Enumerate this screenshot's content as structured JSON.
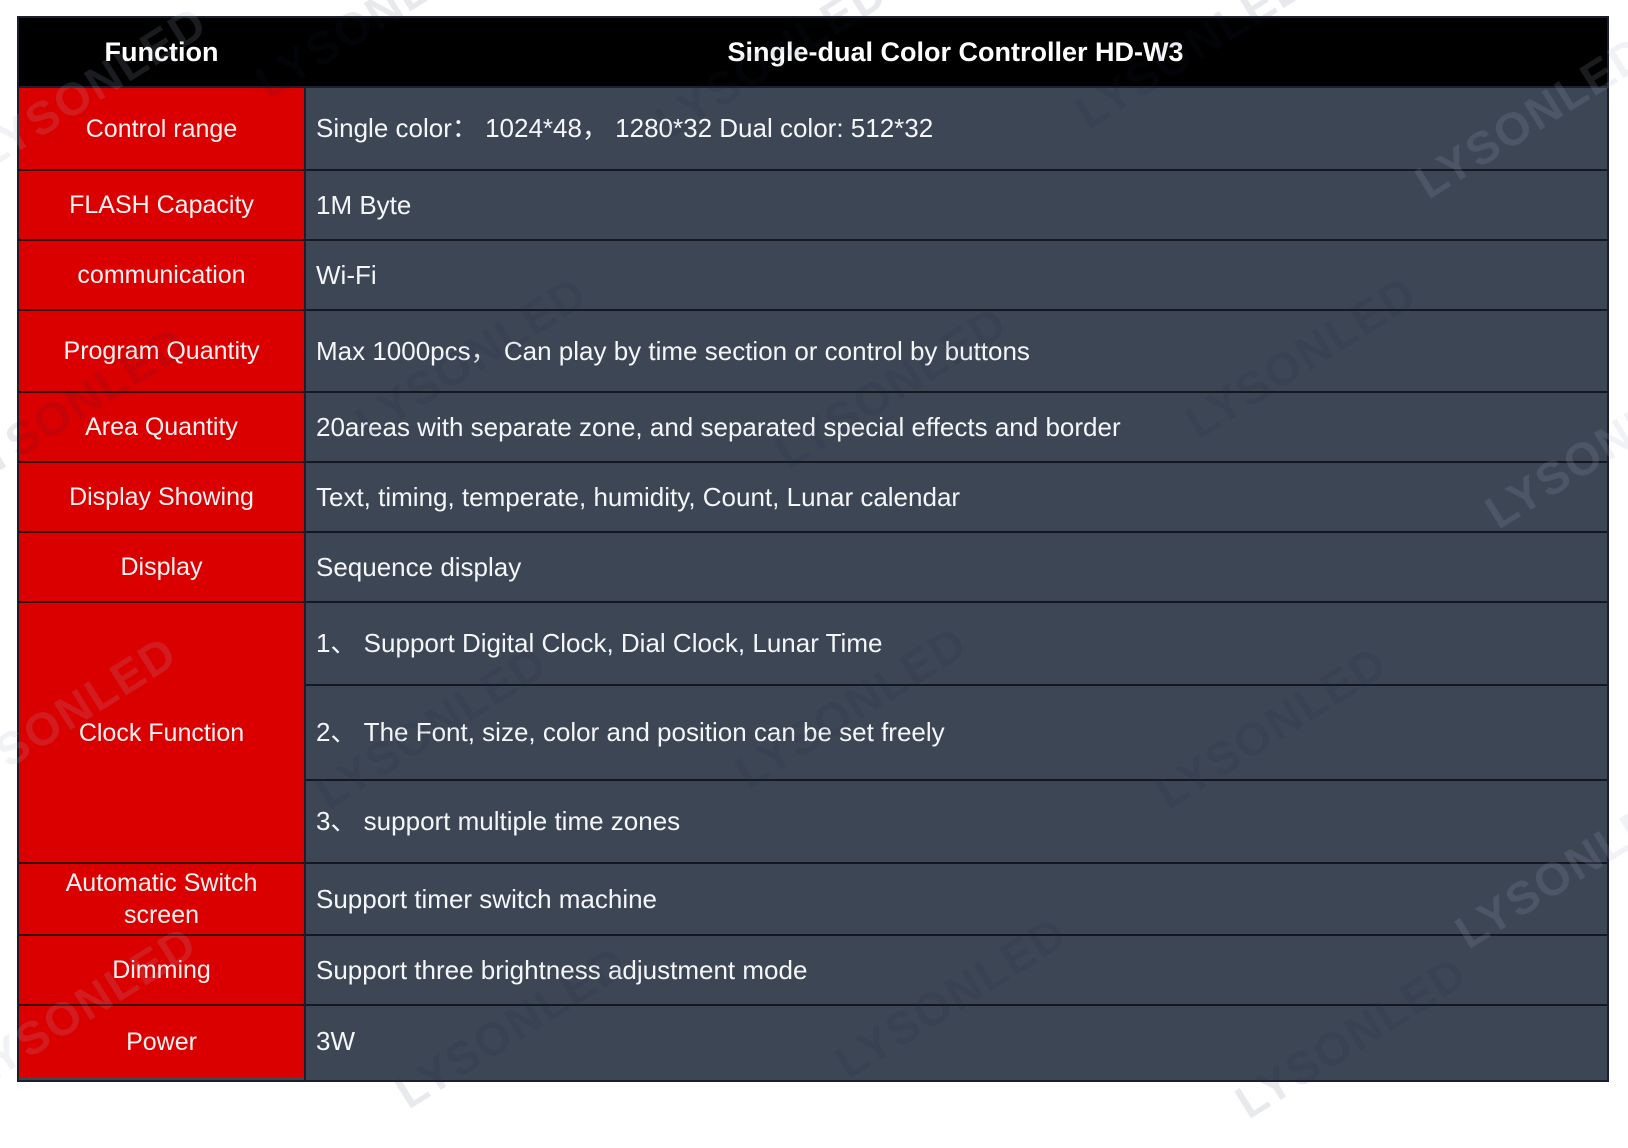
{
  "table": {
    "header": {
      "function_label": "Function",
      "model_label": "Single-dual Color Controller HD-W3"
    },
    "rows": [
      {
        "function": "Control range",
        "value": "Single color：  1024*48，  1280*32      Dual color: 512*32"
      },
      {
        "function": "FLASH Capacity",
        "value": "1M Byte"
      },
      {
        "function": "communication",
        "value": "Wi-Fi"
      },
      {
        "function": "Program Quantity",
        "value": "Max 1000pcs，  Can play by time section or control by buttons"
      },
      {
        "function": "Area Quantity",
        "value": "20areas with separate zone, and separated special effects and border"
      },
      {
        "function": "Display Showing",
        "value": "Text, timing, temperate, humidity, Count, Lunar calendar"
      },
      {
        "function": "Display",
        "value": "Sequence display"
      },
      {
        "function": "Clock Function",
        "value": null,
        "sub_values": [
          "1、 Support Digital Clock, Dial Clock, Lunar Time",
          "2、 The Font, size, color and position can be set freely",
          "3、 support multiple time zones"
        ]
      },
      {
        "function": "Automatic Switch screen",
        "value": "Support timer switch machine"
      },
      {
        "function": "Dimming",
        "value": "Support three brightness adjustment mode"
      },
      {
        "function": "Power",
        "value": "3W"
      }
    ],
    "colors": {
      "header_bg": "#000000",
      "function_bg": "#da0000",
      "value_bg": "#3c4655",
      "text": "#ffffff",
      "border": "#1b1f2b",
      "page_bg": "#ffffff"
    }
  },
  "watermark": {
    "text": "LYSONLED"
  }
}
